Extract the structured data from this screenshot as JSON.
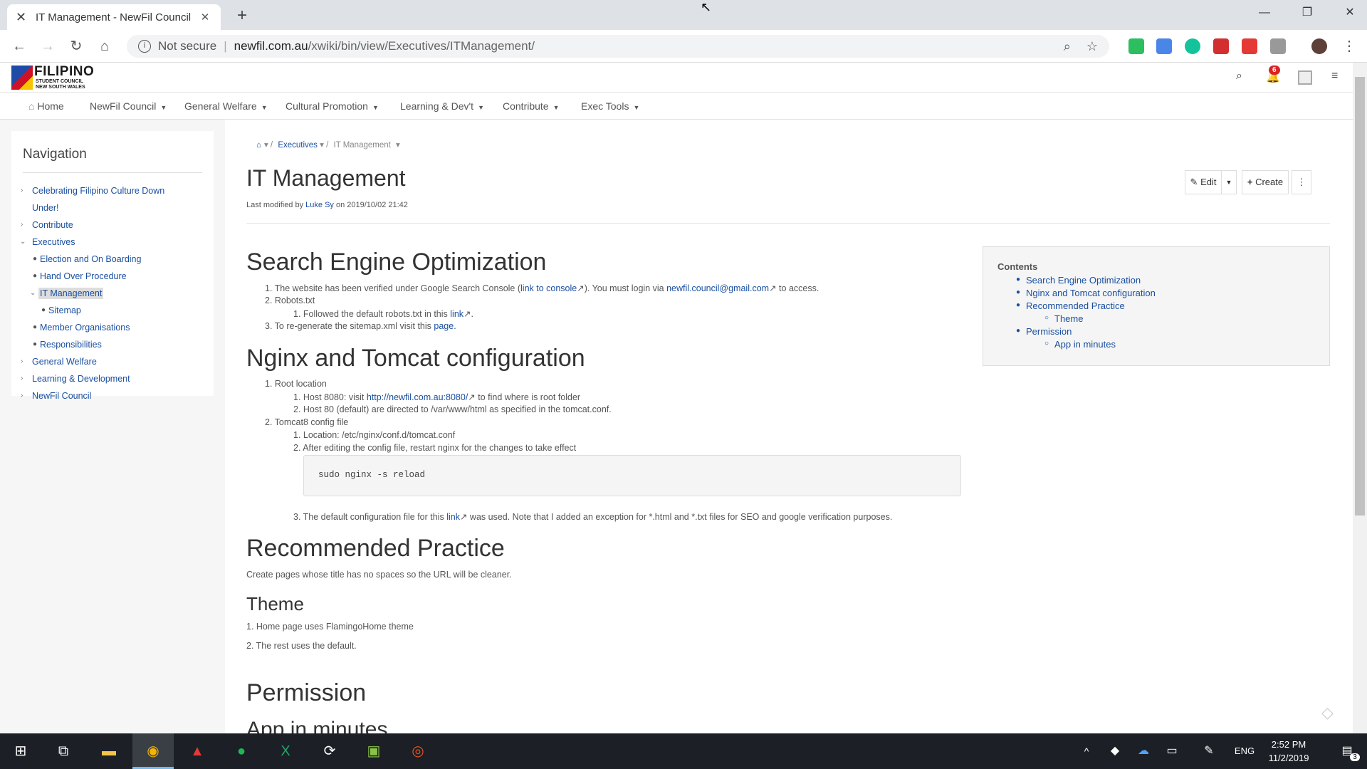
{
  "browser": {
    "tab_title": "IT Management - NewFil Council",
    "not_secure": "Not secure",
    "url_host": "newfil.com.au",
    "url_path": "/xwiki/bin/view/Executives/ITManagement/"
  },
  "site": {
    "logo_line1": "FILIPINO",
    "logo_line2": "STUDENT COUNCIL",
    "logo_line3": "NEW SOUTH WALES",
    "notif_count": "6"
  },
  "mainnav": [
    "Home",
    "NewFil Council",
    "General Welfare",
    "Cultural Promotion",
    "Learning & Dev't",
    "Contribute",
    "Exec Tools"
  ],
  "sidebar": {
    "title": "Navigation",
    "items": [
      "Celebrating Filipino Culture Down",
      "Under!",
      "Contribute",
      "Executives",
      "Election and On Boarding",
      "Hand Over Procedure",
      "IT Management",
      "Sitemap",
      "Member Organisations",
      "Responsibilities",
      "General Welfare",
      "Learning & Development",
      "NewFil Council"
    ]
  },
  "breadcrumb": [
    "Executives",
    "IT Management"
  ],
  "page": {
    "title": "IT Management",
    "modified_prefix": "Last modified by",
    "modified_by": "Luke Sy",
    "modified_on": "on 2019/10/02 21:42",
    "edit": "Edit",
    "create": "Create"
  },
  "seo": {
    "heading": "Search Engine Optimization",
    "l1a": "1. The website has been verified under Google Search Console (",
    "l1link": "link to console",
    "l1b": "). You must login via",
    "l1mail": "newfil.council@gmail.com",
    "l1c": "to access.",
    "l2": "2. Robots.txt",
    "l2a": "1. Followed the default robots.txt in this",
    "l2alink": "link",
    "l3a": "3. To re-generate the sitemap.xml visit this",
    "l3link": "page."
  },
  "nginx": {
    "heading": "Nginx and Tomcat configuration",
    "l1": "1. Root location",
    "l1a_pre": "1. Host 8080: visit",
    "l1a_link": "http://newfil.com.au:8080/",
    "l1a_post": "to find where is root folder",
    "l1b": "2. Host 80 (default) are directed to /var/www/html as specified in the tomcat.conf.",
    "l2": "2. Tomcat8 config file",
    "l2a": "1. Location: /etc/nginx/conf.d/tomcat.conf",
    "l2b": "2. After editing the config file, restart nginx for the changes to take effect",
    "code": "sudo nginx -s reload",
    "l2c_pre": "3. The default configuration file for this",
    "l2c_link": "link",
    "l2c_post": "was used. Note that I added an exception for *.html and *.txt files for SEO and google verification purposes."
  },
  "practice": {
    "heading": "Recommended Practice",
    "text": "Create pages whose title has no spaces so the URL will be cleaner.",
    "theme": "Theme",
    "t1": "1. Home page uses FlamingoHome theme",
    "t2": "2. The rest uses the default."
  },
  "permission": {
    "heading": "Permission",
    "sub": "App in minutes"
  },
  "toc": {
    "title": "Contents",
    "items": [
      "Search Engine Optimization",
      "Nginx and Tomcat configuration",
      "Recommended Practice",
      "Theme",
      "Permission",
      "App in minutes"
    ]
  },
  "taskbar": {
    "lang": "ENG",
    "time": "2:52 PM",
    "date": "11/2/2019",
    "notifications": "3"
  }
}
